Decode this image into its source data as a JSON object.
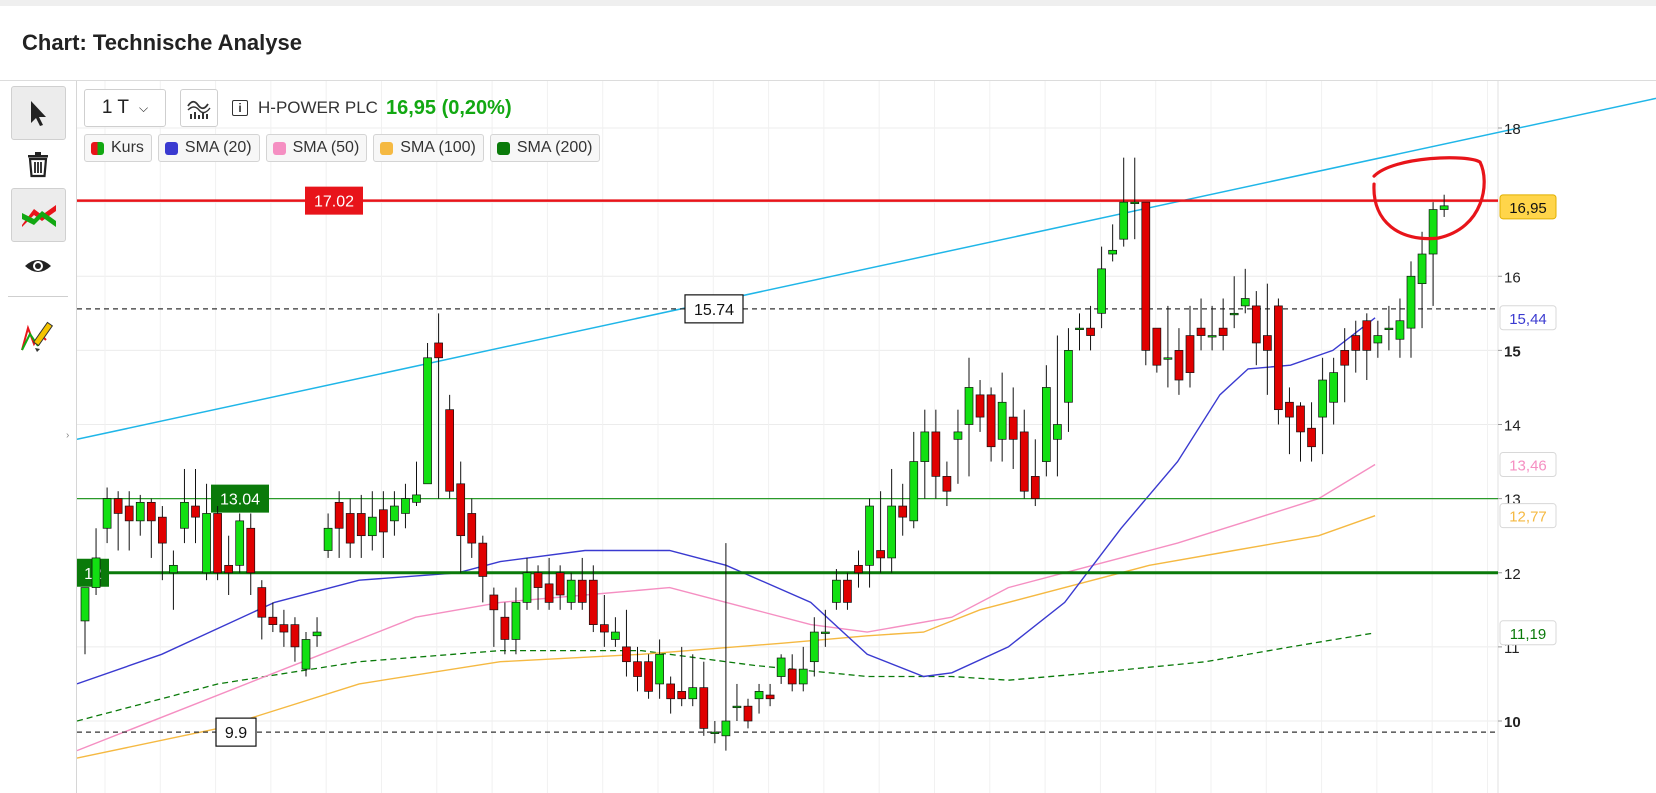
{
  "header": {
    "title": "Chart: Technische Analyse"
  },
  "toolbar": {
    "tools": [
      {
        "name": "cursor-tool",
        "icon": "cursor-icon"
      },
      {
        "name": "delete-tool",
        "icon": "trash-icon"
      },
      {
        "name": "chart-type-tool",
        "icon": "chart-type-icon"
      },
      {
        "name": "visibility-tool",
        "icon": "eye-icon"
      },
      {
        "name": "drawing-tool",
        "icon": "pencil-chart-icon"
      }
    ],
    "more": "›"
  },
  "topbar": {
    "timeframe": "1 T",
    "symbol": "H-POWER PLC",
    "price": "16,95 (0,20%)",
    "price_color": "#12a812"
  },
  "legend": [
    {
      "label": "Kurs",
      "color": "candle"
    },
    {
      "label": "SMA (20)",
      "color": "#3a3ad0"
    },
    {
      "label": "SMA (50)",
      "color": "#f58fc2"
    },
    {
      "label": "SMA (100)",
      "color": "#f5b942"
    },
    {
      "label": "SMA (200)",
      "color": "#0a7a0a"
    }
  ],
  "chart_data": {
    "type": "candlestick",
    "y_ticks": [
      "18",
      "16",
      "15",
      "14",
      "13",
      "12",
      "11",
      "10"
    ],
    "y_tick_values": [
      18,
      16,
      15,
      14,
      13,
      12,
      11,
      10
    ],
    "ylim": [
      9.6,
      18.7
    ],
    "price_tag": {
      "label": "16,95",
      "value": 16.95
    },
    "ma_tags": [
      {
        "label": "15,44",
        "value": 15.44,
        "color": "#3a3ad0"
      },
      {
        "label": "13,46",
        "value": 13.46,
        "color": "#f58fc2"
      },
      {
        "label": "12,77",
        "value": 12.77,
        "color": "#f5b942"
      },
      {
        "label": "11,19",
        "value": 11.19,
        "color": "#0a7a0a"
      }
    ],
    "hlines": [
      {
        "label": "17.02",
        "value": 17.02,
        "color": "#e8141a",
        "style": "solid"
      },
      {
        "label": "15.74",
        "value": 15.56,
        "color": "#333333",
        "style": "dashed"
      },
      {
        "label": "13.04",
        "value": 13.0,
        "color": "#2a9a2a",
        "style": "solid"
      },
      {
        "label": "12",
        "value": 12.0,
        "color": "#0a7a0a",
        "style": "solid-bold"
      },
      {
        "label": "9.9",
        "value": 9.85,
        "color": "#333333",
        "style": "dashed"
      }
    ],
    "candles": [
      [
        11.35,
        11.8,
        10.9,
        11.8
      ],
      [
        11.8,
        12.2,
        11.7,
        12.6
      ],
      [
        12.6,
        13.0,
        12.4,
        13.15
      ],
      [
        13.0,
        12.8,
        12.3,
        13.1
      ],
      [
        12.9,
        12.7,
        12.3,
        13.1
      ],
      [
        12.7,
        12.95,
        12.5,
        13.05
      ],
      [
        12.95,
        12.7,
        12.2,
        13.0
      ],
      [
        12.75,
        12.4,
        11.9,
        12.9
      ],
      [
        12.0,
        12.1,
        11.5,
        12.3
      ],
      [
        12.6,
        12.95,
        12.4,
        13.4
      ],
      [
        12.9,
        12.75,
        12.4,
        13.4
      ],
      [
        12.0,
        12.8,
        11.9,
        13.2
      ],
      [
        12.8,
        12.0,
        11.9,
        12.9
      ],
      [
        12.1,
        12.0,
        11.7,
        12.5
      ],
      [
        12.1,
        12.7,
        12.0,
        12.8
      ],
      [
        12.6,
        12.0,
        11.7,
        12.8
      ],
      [
        11.8,
        11.4,
        11.1,
        11.9
      ],
      [
        11.4,
        11.3,
        11.2,
        11.6
      ],
      [
        11.3,
        11.2,
        11.0,
        11.5
      ],
      [
        11.3,
        11.0,
        10.8,
        11.4
      ],
      [
        10.7,
        11.1,
        10.6,
        11.2
      ],
      [
        11.15,
        11.2,
        11.0,
        11.4
      ],
      [
        12.3,
        12.6,
        12.2,
        12.8
      ],
      [
        12.95,
        12.6,
        12.2,
        13.1
      ],
      [
        12.8,
        12.4,
        12.2,
        13.0
      ],
      [
        12.8,
        12.5,
        12.2,
        13.05
      ],
      [
        12.5,
        12.75,
        12.3,
        13.1
      ],
      [
        12.85,
        12.55,
        12.2,
        13.1
      ],
      [
        12.7,
        12.9,
        12.5,
        13.1
      ],
      [
        12.8,
        13.0,
        12.6,
        13.2
      ],
      [
        12.95,
        13.05,
        12.9,
        13.5
      ],
      [
        13.2,
        14.9,
        13.2,
        15.1
      ],
      [
        15.1,
        14.9,
        13.0,
        15.5
      ],
      [
        14.2,
        13.1,
        13.0,
        14.4
      ],
      [
        13.2,
        12.5,
        12.0,
        13.5
      ],
      [
        12.8,
        12.4,
        12.2,
        13.0
      ],
      [
        12.4,
        11.95,
        11.6,
        12.5
      ],
      [
        11.7,
        11.5,
        11.0,
        11.8
      ],
      [
        11.4,
        11.1,
        10.9,
        11.6
      ],
      [
        11.1,
        11.6,
        10.9,
        11.8
      ],
      [
        11.6,
        12.0,
        11.5,
        12.2
      ],
      [
        12.0,
        11.8,
        11.5,
        12.1
      ],
      [
        11.85,
        11.6,
        11.5,
        12.2
      ],
      [
        12.0,
        11.7,
        11.5,
        12.1
      ],
      [
        11.6,
        11.9,
        11.5,
        12.0
      ],
      [
        11.9,
        11.6,
        11.5,
        12.2
      ],
      [
        11.9,
        11.3,
        11.2,
        12.1
      ],
      [
        11.3,
        11.2,
        11.0,
        11.7
      ],
      [
        11.1,
        11.2,
        11.0,
        11.4
      ],
      [
        11.0,
        10.8,
        10.6,
        11.5
      ],
      [
        10.8,
        10.6,
        10.4,
        11.0
      ],
      [
        10.8,
        10.4,
        10.3,
        10.9
      ],
      [
        10.5,
        10.9,
        10.3,
        11.1
      ],
      [
        10.5,
        10.3,
        10.1,
        10.6
      ],
      [
        10.4,
        10.3,
        10.2,
        11.0
      ],
      [
        10.3,
        10.45,
        10.2,
        10.9
      ],
      [
        10.45,
        9.9,
        9.8,
        10.8
      ],
      [
        9.85,
        9.85,
        9.7,
        10.0
      ],
      [
        9.8,
        10.0,
        9.6,
        12.4
      ],
      [
        10.2,
        10.2,
        10.0,
        10.5
      ],
      [
        10.2,
        10.0,
        9.9,
        10.3
      ],
      [
        10.3,
        10.4,
        10.1,
        10.5
      ],
      [
        10.35,
        10.3,
        10.2,
        10.5
      ],
      [
        10.6,
        10.85,
        10.5,
        10.9
      ],
      [
        10.7,
        10.5,
        10.4,
        10.9
      ],
      [
        10.5,
        10.7,
        10.4,
        11.0
      ],
      [
        10.8,
        11.2,
        10.6,
        11.4
      ],
      [
        11.2,
        11.2,
        11.0,
        11.5
      ],
      [
        11.6,
        11.9,
        11.5,
        12.05
      ],
      [
        11.9,
        11.6,
        11.5,
        12.0
      ],
      [
        12.1,
        12.0,
        11.8,
        12.3
      ],
      [
        12.1,
        12.9,
        11.8,
        13.0
      ],
      [
        12.3,
        12.2,
        12.0,
        13.1
      ],
      [
        12.2,
        12.9,
        12.0,
        13.4
      ],
      [
        12.9,
        12.75,
        12.5,
        13.2
      ],
      [
        12.7,
        13.5,
        12.6,
        13.9
      ],
      [
        13.5,
        13.9,
        13.0,
        14.2
      ],
      [
        13.9,
        13.3,
        13.0,
        14.2
      ],
      [
        13.3,
        13.1,
        12.9,
        13.5
      ],
      [
        13.8,
        13.9,
        13.2,
        14.2
      ],
      [
        14.0,
        14.5,
        13.3,
        14.9
      ],
      [
        14.4,
        14.1,
        13.9,
        14.6
      ],
      [
        14.4,
        13.7,
        13.5,
        14.5
      ],
      [
        13.8,
        14.3,
        13.5,
        14.7
      ],
      [
        14.1,
        13.8,
        13.4,
        14.5
      ],
      [
        13.9,
        13.1,
        13.0,
        14.2
      ],
      [
        13.3,
        13.0,
        12.9,
        13.8
      ],
      [
        13.5,
        14.5,
        13.3,
        14.8
      ],
      [
        13.8,
        14.0,
        13.3,
        15.2
      ],
      [
        14.3,
        15.0,
        13.9,
        15.3
      ],
      [
        15.3,
        15.3,
        15.0,
        15.5
      ],
      [
        15.3,
        15.2,
        15.0,
        15.6
      ],
      [
        15.5,
        16.1,
        15.3,
        16.4
      ],
      [
        16.3,
        16.35,
        16.2,
        16.7
      ],
      [
        16.5,
        17.0,
        16.4,
        17.6
      ],
      [
        17.0,
        17.0,
        16.5,
        17.6
      ],
      [
        17.0,
        15.0,
        14.8,
        17.0
      ],
      [
        15.3,
        14.8,
        14.7,
        15.3
      ],
      [
        14.9,
        14.9,
        14.5,
        15.6
      ],
      [
        15.0,
        14.6,
        14.4,
        15.3
      ],
      [
        15.2,
        14.7,
        14.5,
        15.6
      ],
      [
        15.3,
        15.2,
        15.0,
        15.7
      ],
      [
        15.2,
        15.2,
        15.0,
        15.6
      ],
      [
        15.3,
        15.2,
        15.0,
        15.7
      ],
      [
        15.5,
        15.5,
        15.3,
        16.0
      ],
      [
        15.6,
        15.7,
        15.5,
        16.1
      ],
      [
        15.6,
        15.1,
        14.8,
        15.8
      ],
      [
        15.2,
        15.0,
        14.4,
        15.9
      ],
      [
        15.6,
        14.2,
        14.0,
        15.7
      ],
      [
        14.3,
        14.1,
        13.6,
        14.5
      ],
      [
        14.25,
        13.9,
        13.5,
        14.3
      ],
      [
        13.95,
        13.7,
        13.5,
        14.3
      ],
      [
        14.1,
        14.6,
        13.6,
        14.9
      ],
      [
        14.3,
        14.7,
        14.0,
        14.9
      ],
      [
        15.0,
        14.8,
        14.3,
        15.3
      ],
      [
        15.2,
        15.0,
        14.7,
        15.4
      ],
      [
        15.4,
        15.0,
        14.6,
        15.5
      ],
      [
        15.1,
        15.2,
        14.9,
        15.4
      ],
      [
        15.3,
        15.3,
        15.0,
        15.6
      ],
      [
        15.15,
        15.4,
        14.9,
        15.7
      ],
      [
        15.3,
        16.0,
        14.9,
        16.2
      ],
      [
        15.9,
        16.3,
        15.3,
        16.6
      ],
      [
        16.3,
        16.9,
        15.6,
        17.0
      ],
      [
        16.9,
        16.95,
        16.8,
        17.1
      ]
    ],
    "sma20": [
      [
        0,
        10.5
      ],
      [
        0.06,
        10.9
      ],
      [
        0.14,
        11.6
      ],
      [
        0.2,
        11.9
      ],
      [
        0.27,
        12.0
      ],
      [
        0.3,
        12.15
      ],
      [
        0.36,
        12.3
      ],
      [
        0.42,
        12.3
      ],
      [
        0.46,
        12.1
      ],
      [
        0.52,
        11.6
      ],
      [
        0.56,
        10.9
      ],
      [
        0.6,
        10.6
      ],
      [
        0.62,
        10.65
      ],
      [
        0.66,
        11.0
      ],
      [
        0.7,
        11.6
      ],
      [
        0.74,
        12.6
      ],
      [
        0.78,
        13.5
      ],
      [
        0.81,
        14.4
      ],
      [
        0.83,
        14.75
      ],
      [
        0.86,
        14.8
      ],
      [
        0.89,
        15.0
      ],
      [
        0.92,
        15.44
      ]
    ],
    "sma50": [
      [
        0,
        9.6
      ],
      [
        0.08,
        10.2
      ],
      [
        0.16,
        10.8
      ],
      [
        0.24,
        11.4
      ],
      [
        0.3,
        11.6
      ],
      [
        0.36,
        11.7
      ],
      [
        0.42,
        11.8
      ],
      [
        0.48,
        11.5
      ],
      [
        0.52,
        11.3
      ],
      [
        0.56,
        11.2
      ],
      [
        0.62,
        11.4
      ],
      [
        0.66,
        11.8
      ],
      [
        0.72,
        12.1
      ],
      [
        0.78,
        12.4
      ],
      [
        0.83,
        12.7
      ],
      [
        0.88,
        13.0
      ],
      [
        0.92,
        13.46
      ]
    ],
    "sma100": [
      [
        0,
        9.5
      ],
      [
        0.1,
        9.9
      ],
      [
        0.2,
        10.5
      ],
      [
        0.3,
        10.8
      ],
      [
        0.4,
        10.9
      ],
      [
        0.5,
        11.05
      ],
      [
        0.56,
        11.15
      ],
      [
        0.6,
        11.2
      ],
      [
        0.64,
        11.5
      ],
      [
        0.7,
        11.8
      ],
      [
        0.76,
        12.1
      ],
      [
        0.82,
        12.3
      ],
      [
        0.88,
        12.5
      ],
      [
        0.92,
        12.77
      ]
    ],
    "sma200": [
      [
        0,
        10.0
      ],
      [
        0.1,
        10.5
      ],
      [
        0.2,
        10.8
      ],
      [
        0.3,
        10.95
      ],
      [
        0.4,
        10.95
      ],
      [
        0.48,
        10.75
      ],
      [
        0.56,
        10.6
      ],
      [
        0.62,
        10.6
      ],
      [
        0.66,
        10.55
      ],
      [
        0.72,
        10.65
      ],
      [
        0.8,
        10.8
      ],
      [
        0.86,
        11.0
      ],
      [
        0.92,
        11.19
      ]
    ],
    "trendline": {
      "from": {
        "i": 0,
        "v": 13.8
      },
      "to": {
        "i": 135,
        "v": 18.4
      },
      "color": "#1fb6e8"
    },
    "annotation": {
      "type": "circle",
      "color": "#e8141a",
      "near_value": 17.0
    }
  }
}
